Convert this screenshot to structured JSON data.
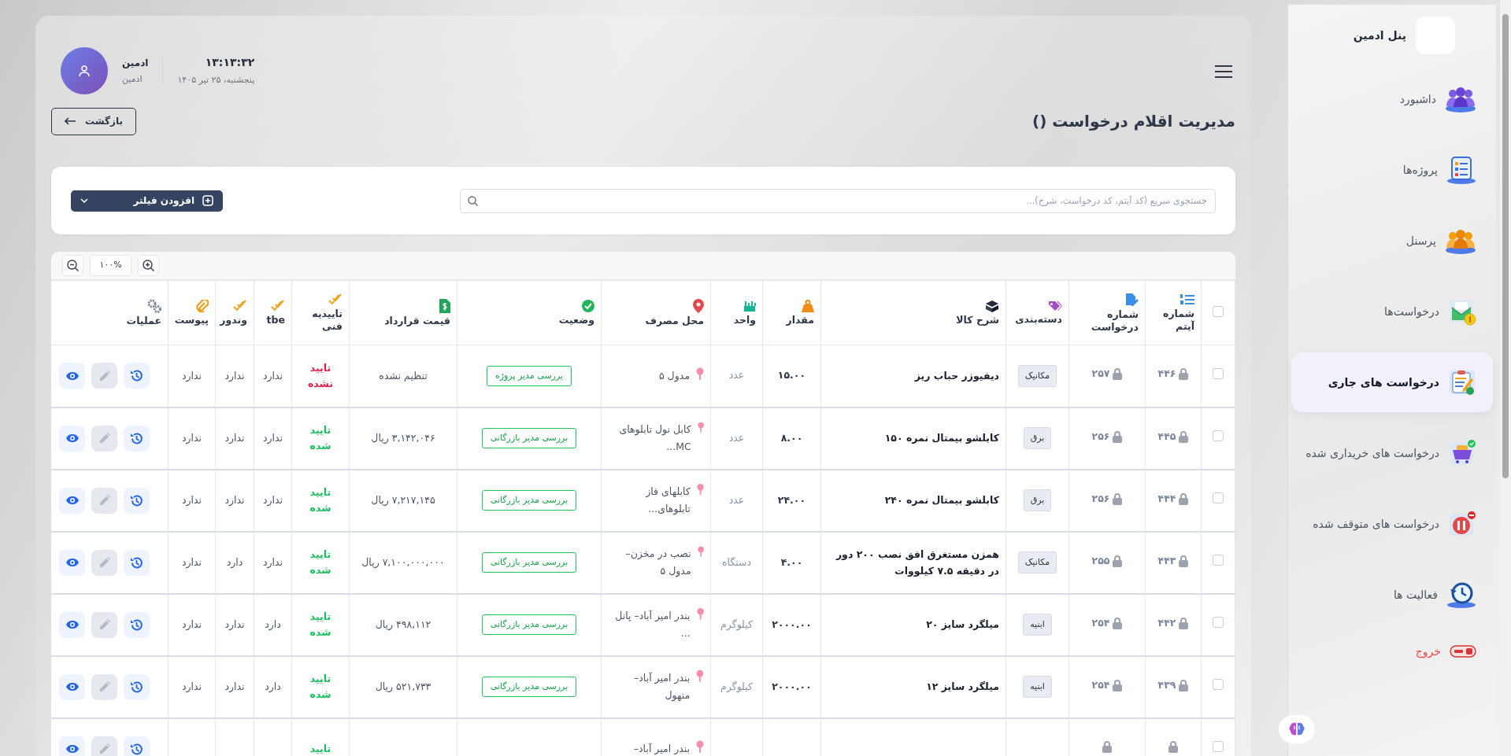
{
  "sidebar": {
    "title": "پنل ادمین",
    "items": [
      {
        "label": "داشبورد",
        "kind": "link",
        "selected": false
      },
      {
        "label": "پروژه‌ها",
        "kind": "link",
        "selected": false
      },
      {
        "label": "پرسنل",
        "kind": "link",
        "selected": false
      },
      {
        "label": "درخواست‌ها",
        "kind": "link",
        "selected": false
      },
      {
        "label": "درخواست های جاری",
        "kind": "link",
        "selected": true
      },
      {
        "label": "درخواست های خریداری شده",
        "kind": "link",
        "selected": false
      },
      {
        "label": "درخواست های متوقف شده",
        "kind": "link",
        "selected": false
      },
      {
        "label": "فعالیت ها",
        "kind": "link",
        "selected": false
      },
      {
        "label": "خروج",
        "kind": "logout",
        "selected": false
      }
    ]
  },
  "header": {
    "time": "۱۳:۱۳:۳۲",
    "date": "پنجشنبه، ۲۵ تیر ۱۴۰۵",
    "user_name": "ادمین",
    "user_role": "ادمین"
  },
  "page": {
    "title": "مدیریت اقلام درخواست ()",
    "back_button": "بازگشت"
  },
  "filters": {
    "search": {
      "placeholder": "جستجوی سریع (کد آیتم، کد درخواست، شرح)..."
    },
    "add_filter_button": "افزودن فیلتر"
  },
  "table": {
    "zoom": "۱۰۰%",
    "select_all_checked": false,
    "columns": [
      "شماره آیتم",
      "شماره درخواست",
      "دسته‌بندی",
      "شرح کالا",
      "مقدار",
      "واحد",
      "محل مصرف",
      "وضعیت",
      "قیمت قرارداد",
      "تاییدیه فنی",
      "tbe",
      "وندور",
      "پیوست",
      "عملیات"
    ],
    "rows": [
      {
        "checked": false,
        "item_no": "۴۴۶",
        "request_no": "۲۵۷",
        "category": "مکانیک",
        "description": "دیفیوزر حباب ریز",
        "quantity": "۱۵.۰۰",
        "unit": "عدد",
        "location": "مدول ۵",
        "status": "بررسی مدیر پروژه",
        "price": "تنظیم نشده",
        "tech_approval": {
          "text": "تایید نشده",
          "approved": false
        },
        "tbe": "ندارد",
        "vendor": "ندارد",
        "attachment": "ندارد",
        "edit_disabled": true
      },
      {
        "checked": false,
        "item_no": "۴۴۵",
        "request_no": "۲۵۶",
        "category": "برق",
        "description": "کابلشو بیمتال نمره ۱۵۰",
        "quantity": "۸.۰۰",
        "unit": "عدد",
        "location": "کابل نول تابلوهای MC...",
        "status": "بررسی مدیر بازرگانی",
        "price": "۳,۱۴۲,۰۴۶ ریال",
        "tech_approval": {
          "text": "تایید شده",
          "approved": true
        },
        "tbe": "ندارد",
        "vendor": "ندارد",
        "attachment": "ندارد",
        "edit_disabled": true
      },
      {
        "checked": false,
        "item_no": "۴۴۴",
        "request_no": "۲۵۶",
        "category": "برق",
        "description": "کابلشو بیمتال نمره ۲۴۰",
        "quantity": "۲۴.۰۰",
        "unit": "عدد",
        "location": "کابلهای فاز تابلوهای...",
        "status": "بررسی مدیر بازرگانی",
        "price": "۷,۲۱۷,۱۴۵ ریال",
        "tech_approval": {
          "text": "تایید شده",
          "approved": true
        },
        "tbe": "ندارد",
        "vendor": "ندارد",
        "attachment": "ندارد",
        "edit_disabled": true
      },
      {
        "checked": false,
        "item_no": "۴۴۳",
        "request_no": "۲۵۵",
        "category": "مکانیک",
        "description": "همزن مستغرق افق نصب ۲۰۰ دور در دقیقه ۷.۵ کیلووات",
        "quantity": "۴.۰۰",
        "unit": "دستگاه",
        "location": "نصب در مخزن– مدول ۵",
        "status": "بررسی مدیر بازرگانی",
        "price": "۷,۱۰۰,۰۰۰,۰۰۰ ریال",
        "tech_approval": {
          "text": "تایید شده",
          "approved": true
        },
        "tbe": "ندارد",
        "vendor": "دارد",
        "attachment": "ندارد",
        "edit_disabled": true
      },
      {
        "checked": false,
        "item_no": "۴۴۲",
        "request_no": "۲۵۴",
        "category": "ابنیه",
        "description": "میلگرد سایز ۲۰",
        "quantity": "۲۰۰۰.۰۰",
        "unit": "کیلوگرم",
        "location": "بندر امیر آباد– پانل ...",
        "status": "بررسی مدیر بازرگانی",
        "price": "۴۹۸,۱۱۲ ریال",
        "tech_approval": {
          "text": "تایید شده",
          "approved": true
        },
        "tbe": "دارد",
        "vendor": "ندارد",
        "attachment": "ندارد",
        "edit_disabled": true
      },
      {
        "checked": false,
        "item_no": "۴۳۹",
        "request_no": "۲۵۴",
        "category": "ابنیه",
        "description": "میلگرد سایز ۱۲",
        "quantity": "۲۰۰۰.۰۰",
        "unit": "کیلوگرم",
        "location": "بندر امیر آباد– منهول",
        "status": "بررسی مدیر بازرگانی",
        "price": "۵۲۱,۷۳۳ ریال",
        "tech_approval": {
          "text": "تایید شده",
          "approved": true
        },
        "tbe": "دارد",
        "vendor": "ندارد",
        "attachment": "ندارد",
        "edit_disabled": true
      },
      {
        "checked": false,
        "location": "بندر امیر آباد–",
        "tech_approval": {
          "text": "تایید",
          "approved": true
        },
        "edit_disabled": true
      }
    ]
  }
}
